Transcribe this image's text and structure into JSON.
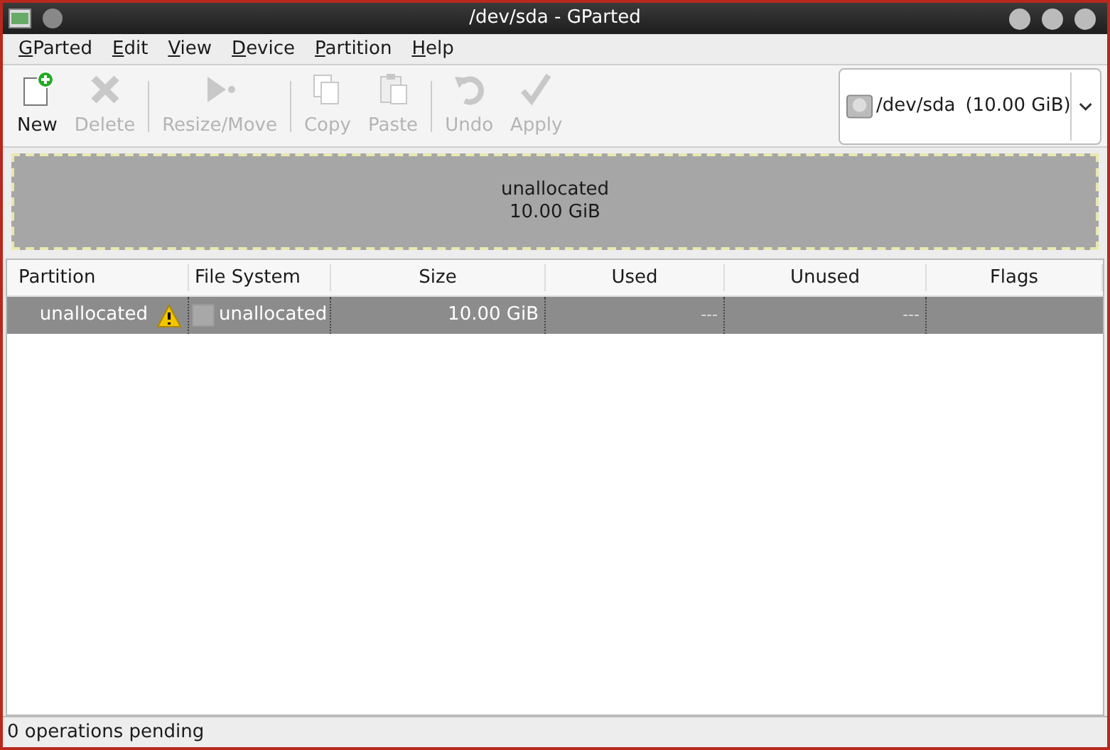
{
  "window": {
    "title": "/dev/sda - GParted"
  },
  "menu": [
    {
      "label": "GParted"
    },
    {
      "label": "Edit"
    },
    {
      "label": "View"
    },
    {
      "label": "Device"
    },
    {
      "label": "Partition"
    },
    {
      "label": "Help"
    }
  ],
  "toolbar": [
    {
      "kind": "new",
      "label": "New",
      "disabled": false
    },
    {
      "kind": "delete",
      "label": "Delete",
      "disabled": true
    },
    {
      "kind": "sep"
    },
    {
      "kind": "resize",
      "label": "Resize/Move",
      "disabled": true
    },
    {
      "kind": "sep"
    },
    {
      "kind": "copy",
      "label": "Copy",
      "disabled": true
    },
    {
      "kind": "paste",
      "label": "Paste",
      "disabled": true
    },
    {
      "kind": "sep"
    },
    {
      "kind": "undo",
      "label": "Undo",
      "disabled": true
    },
    {
      "kind": "apply",
      "label": "Apply",
      "disabled": true
    }
  ],
  "device": {
    "name": "/dev/sda",
    "size": "(10.00 GiB)"
  },
  "disk_map": {
    "label": "unallocated",
    "size": "10.00 GiB"
  },
  "table": {
    "columns": [
      "Partition",
      "File System",
      "Size",
      "Used",
      "Unused",
      "Flags"
    ],
    "rows": [
      {
        "selected": true,
        "warning": true,
        "partition": "unallocated",
        "file_system": "unallocated",
        "size": "10.00 GiB",
        "used": "---",
        "unused": "---"
      }
    ]
  },
  "status_bar": "0 operations pending"
}
